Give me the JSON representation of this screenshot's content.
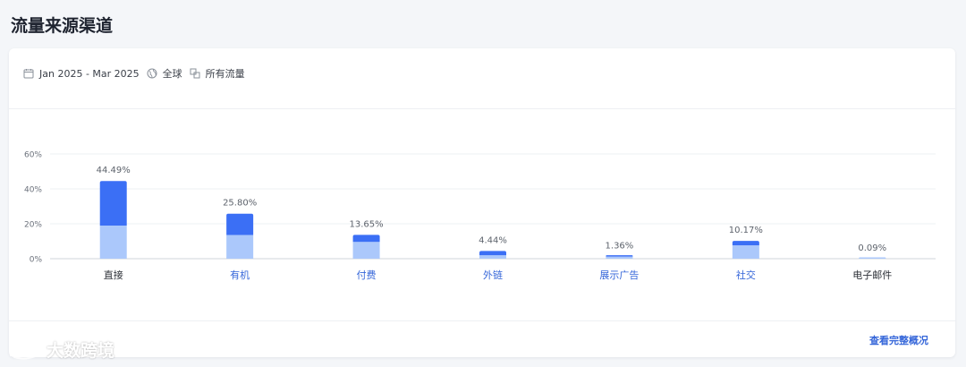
{
  "page": {
    "title": "流量来源渠道"
  },
  "filters": {
    "date_range": "Jan 2025 - Mar 2025",
    "region": "全球",
    "traffic_type": "所有流量"
  },
  "colors": {
    "primary_bar": "#3b6ff5",
    "secondary_bar": "#abc8fb",
    "link": "#3566d9",
    "category_plain": "#2b2f36"
  },
  "chart_data": {
    "type": "bar",
    "stacked": true,
    "categories": [
      "直接",
      "有机",
      "付费",
      "外链",
      "展示广告",
      "社交",
      "电子邮件"
    ],
    "category_is_link": [
      false,
      true,
      true,
      true,
      true,
      true,
      false
    ],
    "totals": [
      44.49,
      25.8,
      13.65,
      4.44,
      1.36,
      10.17,
      0.09
    ],
    "total_labels": [
      "44.49%",
      "25.80%",
      "13.65%",
      "4.44%",
      "1.36%",
      "10.17%",
      "0.09%"
    ],
    "series": [
      {
        "values": [
          19.0,
          13.6,
          9.6,
          2.0,
          1.2,
          7.6,
          0.09
        ]
      },
      {
        "values": [
          25.49,
          12.2,
          4.05,
          2.44,
          0.16,
          2.57,
          0.0
        ]
      }
    ],
    "yticks": [
      "0%",
      "20%",
      "40%",
      "60%"
    ],
    "ytick_values": [
      0,
      20,
      40,
      60
    ],
    "ylim": [
      0,
      60
    ],
    "grid": true
  },
  "footer": {
    "link_label": "查看完整概况"
  },
  "watermark": {
    "text": "大数跨境"
  }
}
